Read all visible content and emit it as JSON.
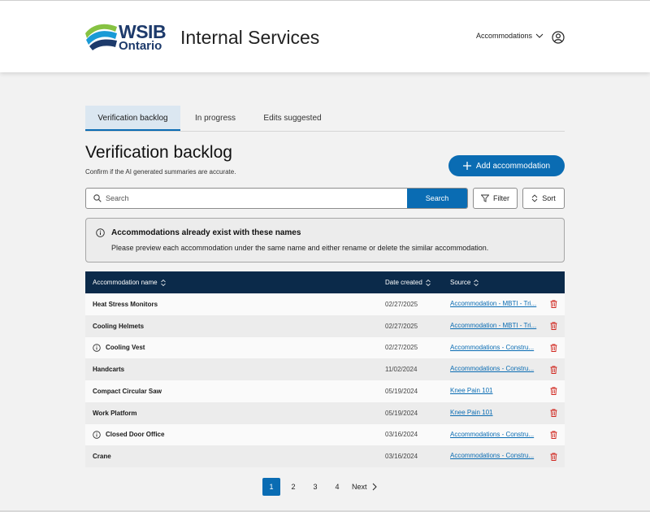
{
  "header": {
    "logo_line1": "WSIB",
    "logo_line2": "Ontario",
    "app_title": "Internal Services",
    "menu_label": "Accommodations"
  },
  "tabs": [
    {
      "label": "Verification backlog",
      "active": true
    },
    {
      "label": "In progress",
      "active": false
    },
    {
      "label": "Edits suggested",
      "active": false
    }
  ],
  "page": {
    "title": "Verification backlog",
    "subtitle": "Confirm if the AI generated summaries are accurate.",
    "add_button": "Add accommodation"
  },
  "search": {
    "placeholder": "Search",
    "button": "Search",
    "filter": "Filter",
    "sort": "Sort"
  },
  "alert": {
    "title": "Accommodations already exist with these names",
    "body": "Please preview each accommodation under the same name and either rename or delete the similar accommodation."
  },
  "table": {
    "columns": [
      "Accommodation name",
      "Date created",
      "Source"
    ],
    "rows": [
      {
        "name": "Heat Stress Monitors",
        "date": "02/27/2025",
        "source": "Accommodation - MBTI - Tri...",
        "info": false
      },
      {
        "name": "Cooling Helmets",
        "date": "02/27/2025",
        "source": "Accommodation - MBTI - Tri...",
        "info": false
      },
      {
        "name": "Cooling Vest",
        "date": "02/27/2025",
        "source": "Accommodations - Constru...",
        "info": true
      },
      {
        "name": "Handcarts",
        "date": "11/02/2024",
        "source": "Accommodations - Constru...",
        "info": false
      },
      {
        "name": "Compact Circular Saw",
        "date": "05/19/2024",
        "source": "Knee Pain 101",
        "info": false
      },
      {
        "name": "Work Platform",
        "date": "05/19/2024",
        "source": "Knee Pain 101",
        "info": false
      },
      {
        "name": "Closed Door Office",
        "date": "03/16/2024",
        "source": "Accommodations - Constru...",
        "info": true
      },
      {
        "name": "Crane",
        "date": "03/16/2024",
        "source": "Accommodations - Constru...",
        "info": false
      }
    ]
  },
  "pagination": {
    "pages": [
      "1",
      "2",
      "3",
      "4"
    ],
    "current": "1",
    "next": "Next"
  },
  "colors": {
    "primary": "#0a6cb3",
    "table_header": "#0b2a4a",
    "delete": "#d0261e",
    "tab_active_bg": "#dbe7f1"
  }
}
